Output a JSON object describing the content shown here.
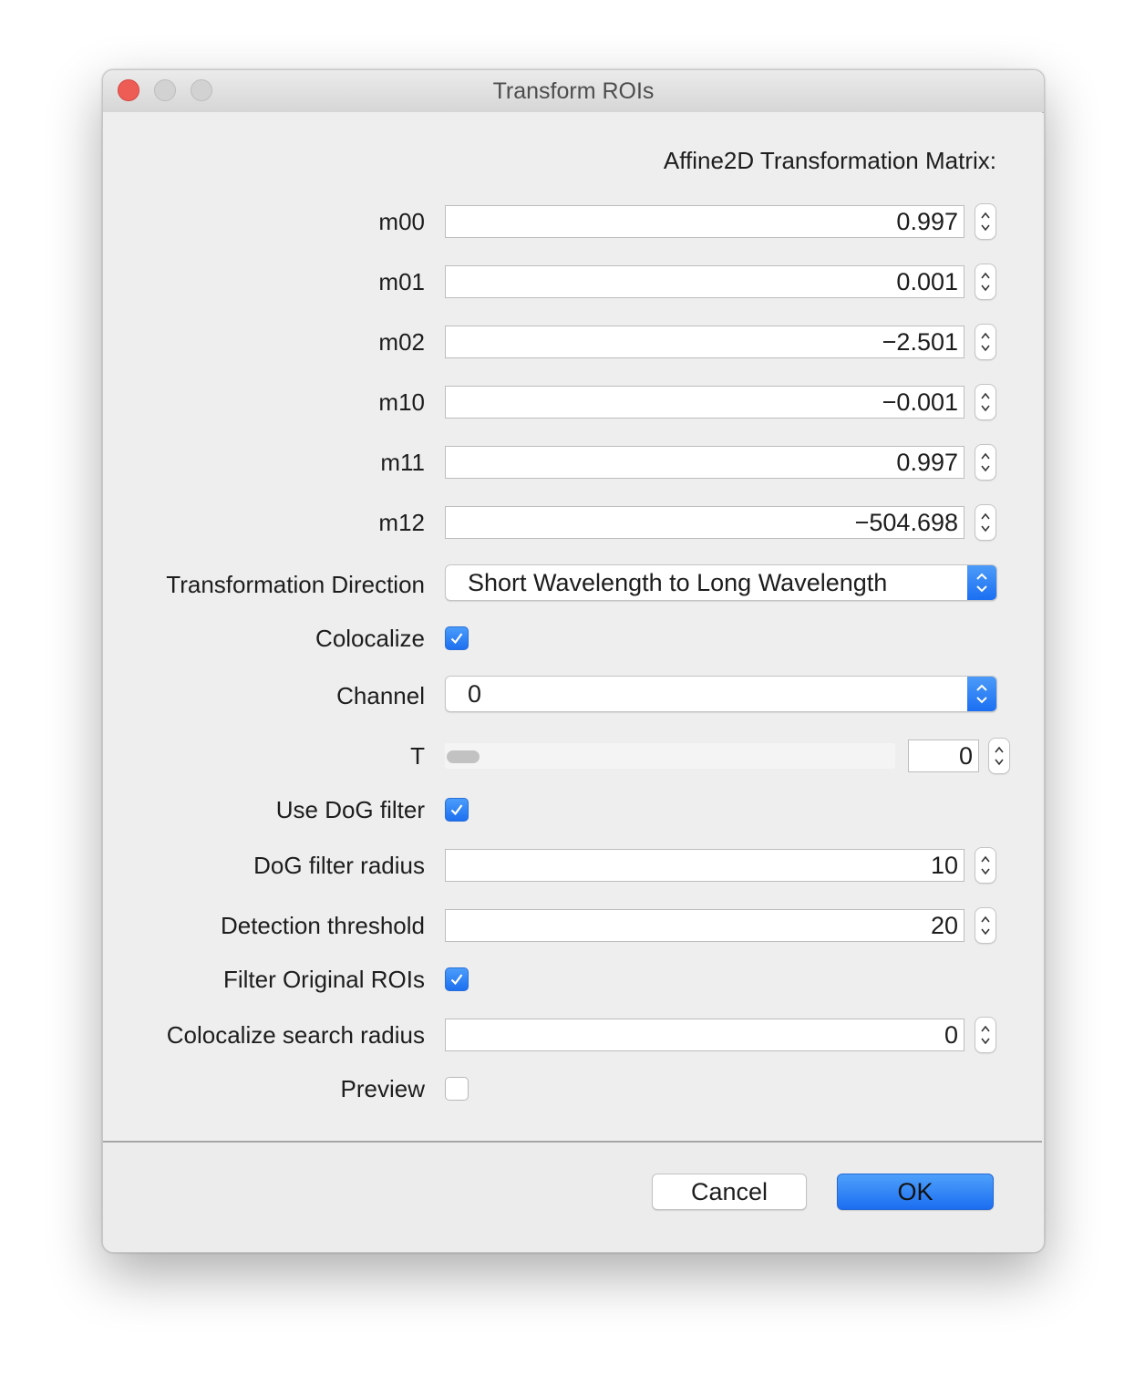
{
  "window": {
    "title": "Transform ROIs"
  },
  "heading": "Affine2D Transformation Matrix:",
  "matrix": [
    {
      "label": "m00",
      "value": "0.997"
    },
    {
      "label": "m01",
      "value": "0.001"
    },
    {
      "label": "m02",
      "value": "−2.501"
    },
    {
      "label": "m10",
      "value": "−0.001"
    },
    {
      "label": "m11",
      "value": "0.997"
    },
    {
      "label": "m12",
      "value": "−504.698"
    }
  ],
  "direction": {
    "label": "Transformation Direction",
    "value": "Short Wavelength to Long Wavelength"
  },
  "colocalize": {
    "label": "Colocalize",
    "checked": true
  },
  "channel": {
    "label": "Channel",
    "value": "0"
  },
  "t": {
    "label": "T",
    "value": "0",
    "slider_fraction": 0
  },
  "use_dog": {
    "label": "Use DoG filter",
    "checked": true
  },
  "dog_radius": {
    "label": "DoG filter radius",
    "value": "10"
  },
  "detection_threshold": {
    "label": "Detection threshold",
    "value": "20"
  },
  "filter_original": {
    "label": "Filter Original ROIs",
    "checked": true
  },
  "search_radius": {
    "label": "Colocalize search radius",
    "value": "0"
  },
  "preview": {
    "label": "Preview",
    "checked": false
  },
  "buttons": {
    "cancel": "Cancel",
    "ok": "OK"
  },
  "colors": {
    "accent": "#1d6ff0",
    "close": "#ee5d55"
  }
}
